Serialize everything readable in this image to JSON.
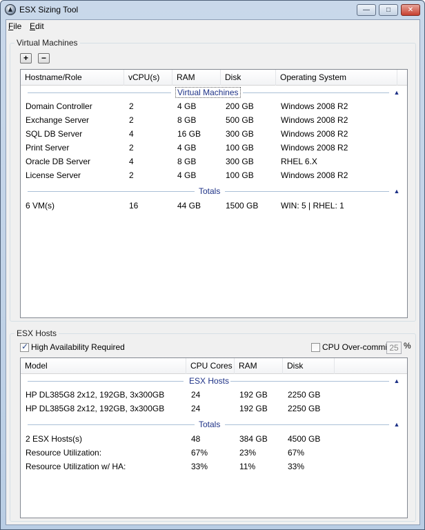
{
  "window": {
    "title": "ESX Sizing Tool",
    "minimize": "—",
    "maximize": "□",
    "close": "✕"
  },
  "menu": [
    {
      "label": "File",
      "accel": "F",
      "rest": "ile"
    },
    {
      "label": "Edit",
      "accel": "E",
      "rest": "dit"
    }
  ],
  "vm_panel": {
    "label": "Virtual Machines",
    "add_button": "+",
    "remove_button": "−",
    "columns": [
      "Hostname/Role",
      "vCPU(s)",
      "RAM",
      "Disk",
      "Operating System"
    ],
    "group_vms": "Virtual Machines",
    "rows": [
      [
        "Domain Controller",
        "2",
        "4 GB",
        "200 GB",
        "Windows 2008 R2"
      ],
      [
        "Exchange Server",
        "2",
        "8 GB",
        "500 GB",
        "Windows 2008 R2"
      ],
      [
        "SQL DB Server",
        "4",
        "16 GB",
        "300 GB",
        "Windows 2008 R2"
      ],
      [
        "Print Server",
        "2",
        "4 GB",
        "100 GB",
        "Windows 2008 R2"
      ],
      [
        "Oracle DB Server",
        "4",
        "8 GB",
        "300 GB",
        "RHEL 6.X"
      ],
      [
        "License Server",
        "2",
        "4 GB",
        "100 GB",
        "Windows 2008 R2"
      ]
    ],
    "group_totals": "Totals",
    "totals": [
      "6 VM(s)",
      "16",
      "44 GB",
      "1500 GB",
      "WIN: 5 | RHEL: 1"
    ]
  },
  "esx_panel": {
    "label": "ESX Hosts",
    "ha_label": "High Availability Required",
    "ha_checked": true,
    "overcommit_label": "CPU Over-commit",
    "overcommit_checked": false,
    "overcommit_value": "25",
    "overcommit_unit": "%",
    "columns": [
      "Model",
      "CPU Cores",
      "RAM",
      "Disk"
    ],
    "group_hosts": "ESX Hosts",
    "rows": [
      [
        "HP DL385G8  2x12, 192GB, 3x300GB",
        "24",
        "192 GB",
        "2250 GB"
      ],
      [
        "HP DL385G8  2x12, 192GB, 3x300GB",
        "24",
        "192 GB",
        "2250 GB"
      ]
    ],
    "group_totals": "Totals",
    "totals": [
      [
        "2 ESX Hosts(s)",
        "48",
        "384 GB",
        "4500 GB"
      ],
      [
        "Resource Utilization:",
        "67%",
        "23%",
        "67%"
      ],
      [
        "Resource Utilization w/ HA:",
        "33%",
        "11%",
        "33%"
      ]
    ]
  },
  "icons": {
    "collapse": "▲",
    "app": "app-logo-icon"
  }
}
